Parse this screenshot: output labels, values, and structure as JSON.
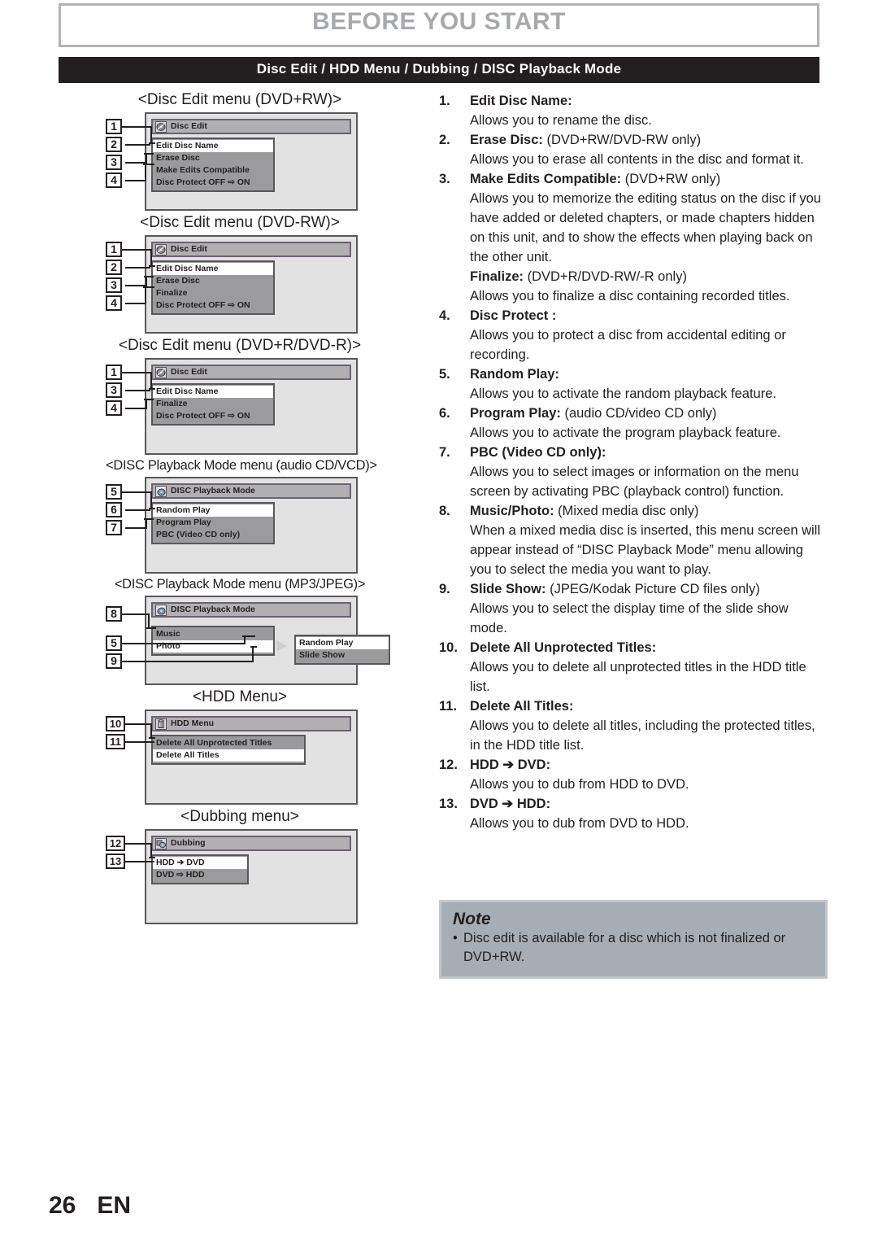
{
  "header": {
    "chapter_title": "BEFORE YOU START",
    "section_title": "Disc Edit / HDD Menu / Dubbing / DISC Playback Mode"
  },
  "diagrams": [
    {
      "caption": "<Disc Edit menu (DVD+RW)>",
      "window_title": "Disc Edit",
      "icon": "disc-icon",
      "items": [
        {
          "label": "Edit Disc Name",
          "selected": true,
          "tag": "1"
        },
        {
          "label": "Erase Disc",
          "selected": false,
          "tag": "2"
        },
        {
          "label": "Make Edits Compatible",
          "selected": false,
          "tag": "3"
        },
        {
          "label": "Disc Protect OFF ⇨ ON",
          "selected": false,
          "tag": "4"
        }
      ]
    },
    {
      "caption": "<Disc Edit menu (DVD-RW)>",
      "window_title": "Disc Edit",
      "icon": "disc-icon",
      "items": [
        {
          "label": "Edit Disc Name",
          "selected": true,
          "tag": "1"
        },
        {
          "label": "Erase Disc",
          "selected": false,
          "tag": "2"
        },
        {
          "label": "Finalize",
          "selected": false,
          "tag": "3"
        },
        {
          "label": "Disc Protect OFF ⇨ ON",
          "selected": false,
          "tag": "4"
        }
      ]
    },
    {
      "caption": "<Disc Edit menu (DVD+R/DVD-R)>",
      "window_title": "Disc Edit",
      "icon": "disc-icon",
      "items": [
        {
          "label": "Edit Disc Name",
          "selected": true,
          "tag": "1"
        },
        {
          "label": "Finalize",
          "selected": false,
          "tag": "3"
        },
        {
          "label": "Disc Protect OFF ⇨ ON",
          "selected": false,
          "tag": "4"
        }
      ]
    },
    {
      "caption": "<DISC Playback Mode menu (audio CD/VCD)>",
      "window_title": "DISC Playback Mode",
      "icon": "playback-mode-icon",
      "items": [
        {
          "label": "Random Play",
          "selected": true,
          "tag": "5"
        },
        {
          "label": "Program Play",
          "selected": false,
          "tag": "6"
        },
        {
          "label": "PBC (Video CD only)",
          "selected": false,
          "tag": "7"
        }
      ]
    },
    {
      "caption": "<DISC Playback Mode menu (MP3/JPEG)>",
      "window_title": "DISC Playback Mode",
      "icon": "playback-mode-icon",
      "items": [
        {
          "label": "Music",
          "selected": false,
          "tag": "8"
        },
        {
          "label": "Photo",
          "selected": true,
          "tag": ""
        }
      ],
      "submenu_items": [
        {
          "label": "Random Play",
          "selected": true,
          "tag": "5"
        },
        {
          "label": "Slide Show",
          "selected": false,
          "tag": "9"
        }
      ]
    },
    {
      "caption": "<HDD Menu>",
      "window_title": "HDD Menu",
      "icon": "hdd-icon",
      "items": [
        {
          "label": "Delete All Unprotected Titles",
          "selected": false,
          "tag": "10"
        },
        {
          "label": "Delete All Titles",
          "selected": true,
          "tag": "11"
        }
      ]
    },
    {
      "caption": "<Dubbing menu>",
      "window_title": "Dubbing",
      "icon": "dubbing-icon",
      "items": [
        {
          "label": "HDD ➔ DVD",
          "selected": true,
          "tag": "12"
        },
        {
          "label": "DVD ⇨ HDD",
          "selected": false,
          "tag": "13"
        }
      ]
    }
  ],
  "entries": [
    {
      "num": "1.",
      "title": "Edit Disc Name:",
      "qualifier": "",
      "body": "Allows you to rename the disc."
    },
    {
      "num": "2.",
      "title": "Erase Disc:",
      "qualifier": " (DVD+RW/DVD-RW only)",
      "body": "Allows you to erase all contents in the disc and format it."
    },
    {
      "num": "3.",
      "title": "Make Edits Compatible:",
      "qualifier": " (DVD+RW only)",
      "body": "Allows you to memorize the editing status on the disc if you have added or deleted chapters, or made chapters hidden on this unit, and to show the effects when playing back on the other unit.",
      "sub_title": "Finalize:",
      "sub_qualifier": " (DVD+R/DVD-RW/-R only)",
      "sub_body": "Allows you to finalize a disc containing recorded titles."
    },
    {
      "num": "4.",
      "title": "Disc Protect :",
      "qualifier": "",
      "body": "Allows you to protect a disc from accidental editing or recording."
    },
    {
      "num": "5.",
      "title": "Random Play:",
      "qualifier": "",
      "body": "Allows you to activate the random playback feature."
    },
    {
      "num": "6.",
      "title": "Program Play:",
      "qualifier": " (audio CD/video CD only)",
      "body": "Allows you to activate the program playback feature."
    },
    {
      "num": "7.",
      "title": "PBC (Video CD only):",
      "qualifier": "",
      "body": "Allows you to select images or information on the menu screen by activating PBC (playback control) function."
    },
    {
      "num": "8.",
      "title": "Music/Photo:",
      "qualifier": " (Mixed media disc only)",
      "body": "When a mixed media disc is inserted, this menu screen will appear instead of “DISC Playback Mode” menu allowing you to select the media you want to play."
    },
    {
      "num": "9.",
      "title": "Slide Show:",
      "qualifier": " (JPEG/Kodak Picture CD files only)",
      "body": "Allows you to select the display time of the slide show mode."
    },
    {
      "num": "10.",
      "title": "Delete All Unprotected Titles:",
      "qualifier": "",
      "body": "Allows you to delete all unprotected titles in the HDD title list."
    },
    {
      "num": "11.",
      "title": "Delete All Titles:",
      "qualifier": "",
      "body": "Allows you to delete all titles, including the protected titles, in the HDD title list."
    },
    {
      "num": "12.",
      "title": "HDD ➔ DVD:",
      "qualifier": "",
      "body": "Allows you to dub from HDD to DVD."
    },
    {
      "num": "13.",
      "title": "DVD ➔ HDD:",
      "qualifier": "",
      "body": "Allows you to dub from DVD to HDD."
    }
  ],
  "note": {
    "title": "Note",
    "items": [
      "Disc edit is available for a disc which is not finalized or DVD+RW."
    ]
  },
  "footer": {
    "page_number": "26",
    "language": "EN"
  },
  "colors": {
    "section_bar": "#231f20",
    "chapter_title": "#a8a9ad",
    "screen_bg": "#e2e2e2",
    "menu_panel": "#9b9b9d",
    "note_bg": "#a7adb4"
  }
}
